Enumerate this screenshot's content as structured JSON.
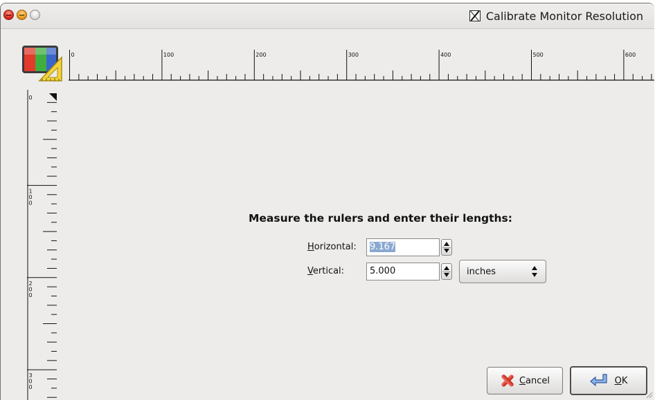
{
  "window": {
    "title": "Calibrate Monitor Resolution"
  },
  "horizontal_ruler": {
    "labels": [
      "0",
      "100",
      "200",
      "300",
      "400",
      "500",
      "600"
    ]
  },
  "vertical_ruler": {
    "labels": [
      [
        "0"
      ],
      [
        "1",
        "0",
        "0"
      ],
      [
        "2",
        "0",
        "0"
      ],
      [
        "3",
        "0",
        "0"
      ]
    ]
  },
  "form": {
    "heading": "Measure the rulers and enter their lengths:",
    "horizontal": {
      "mnemonic": "H",
      "label_rest": "orizontal:",
      "value": "9.167"
    },
    "vertical": {
      "mnemonic": "V",
      "label_rest": "ertical:",
      "value": "5.000"
    },
    "unit": {
      "selected": "inches"
    }
  },
  "buttons": {
    "cancel": {
      "mnemonic": "C",
      "label_rest": "ancel"
    },
    "ok": {
      "mnemonic": "O",
      "label_rest": "K"
    }
  },
  "colors": {
    "selection": "#8ba9d0",
    "window_bg": "#edeceb"
  },
  "icons": [
    "close-button-icon",
    "minimize-button-icon",
    "maximize-button-icon",
    "x11-icon",
    "monitor-calibration-icon",
    "cancel-x-icon",
    "ok-return-arrow-icon",
    "resize-grip-icon"
  ]
}
